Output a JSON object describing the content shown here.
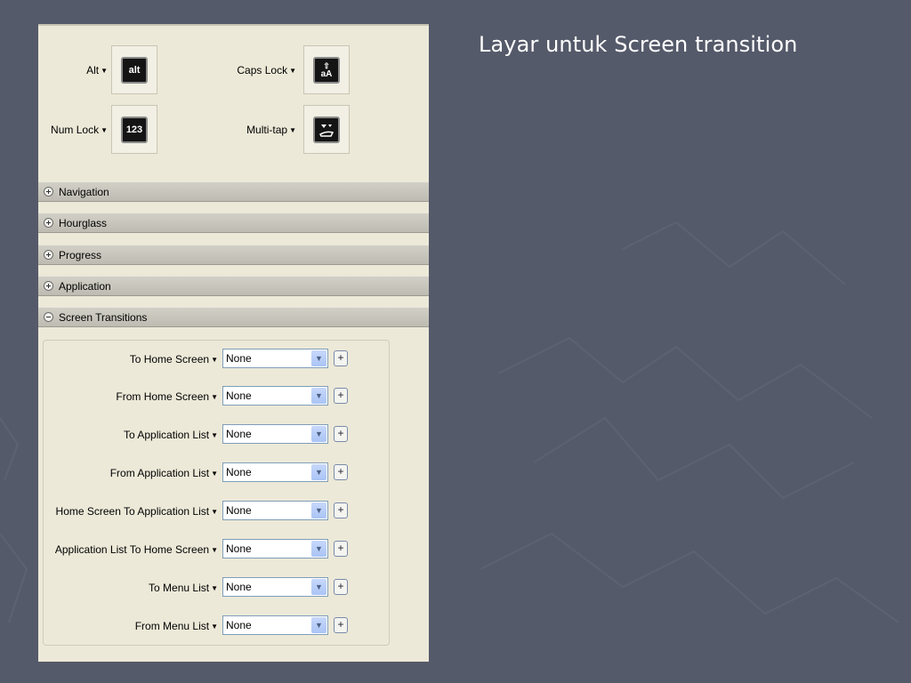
{
  "slide": {
    "title": "Layar untuk Screen transition"
  },
  "colors": {
    "background": "#555a6a",
    "panel": "#ece9d8",
    "header": "#c8c6bc"
  },
  "icons": [
    {
      "label": "Alt",
      "glyph": "alt",
      "icon": "alt-key-icon"
    },
    {
      "label": "Caps Lock",
      "glyph": "aA",
      "icon": "caps-lock-icon"
    },
    {
      "label": "Num Lock",
      "glyph": "123",
      "icon": "num-lock-icon"
    },
    {
      "label": "Multi-tap",
      "glyph": "",
      "icon": "multi-tap-icon"
    }
  ],
  "sections": [
    {
      "label": "Navigation",
      "expanded": false
    },
    {
      "label": "Hourglass",
      "expanded": false
    },
    {
      "label": "Progress",
      "expanded": false
    },
    {
      "label": "Application",
      "expanded": false
    },
    {
      "label": "Screen Transitions",
      "expanded": true
    }
  ],
  "transitions": [
    {
      "label": "To Home Screen",
      "value": "None"
    },
    {
      "label": "From Home Screen",
      "value": "None"
    },
    {
      "label": "To Application List",
      "value": "None"
    },
    {
      "label": "From Application List",
      "value": "None"
    },
    {
      "label": "Home Screen To Application List",
      "value": "None"
    },
    {
      "label": "Application List To Home Screen",
      "value": "None"
    },
    {
      "label": "To Menu List",
      "value": "None"
    },
    {
      "label": "From Menu List",
      "value": "None"
    }
  ],
  "add_button_label": "+"
}
